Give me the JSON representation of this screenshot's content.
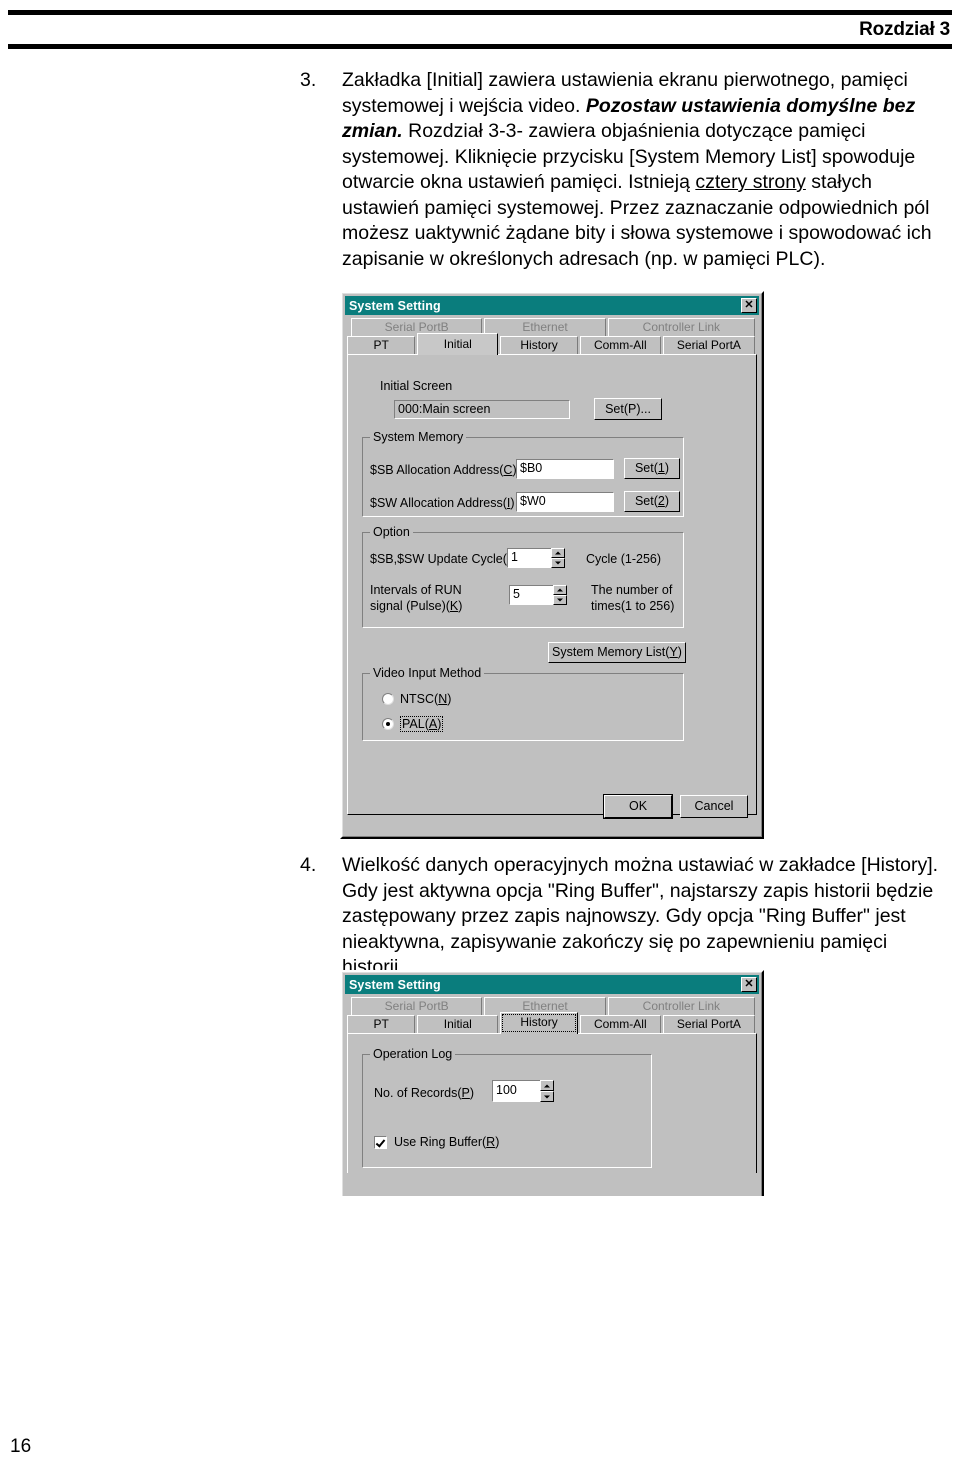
{
  "header": {
    "chapter": "Rozdział 3"
  },
  "footer": {
    "page_number": "16"
  },
  "paragraphs": [
    {
      "number": "3.",
      "runs": [
        {
          "text": "Zakładka [Initial] zawiera ustawienia ekranu pierwotnego, pamięci systemowej i wejścia video. ",
          "style": "normal"
        },
        {
          "text": "Pozostaw ustawienia domyślne bez zmian.",
          "style": "bold-italic"
        },
        {
          "text": " Rozdział 3-3- zawiera objaśnienia dotyczące pamięci systemowej. Kliknięcie przycisku [System Memory List] spowoduje otwarcie okna ustawień pamięci. Istnieją ",
          "style": "normal"
        },
        {
          "text": "cztery strony",
          "style": "underline"
        },
        {
          "text": " stałych ustawień pamięci systemowej. Przez zaznaczanie odpowiednich pól możesz uaktywnić żądane bity i słowa systemowe i spowodować ich zapisanie w określonych adresach (np. w pamięci PLC).",
          "style": "normal"
        }
      ]
    },
    {
      "number": "4.",
      "runs": [
        {
          "text": "Wielkość danych operacyjnych można ustawiać w zakładce [History]. Gdy jest aktywna opcja \"Ring Buffer\", najstarszy zapis historii będzie zastępowany przez zapis najnowszy. Gdy opcja \"Ring Buffer\" jest nieaktywna, zapisywanie zakończy się po zapewnieniu pamięci historii.",
          "style": "normal"
        }
      ]
    }
  ],
  "colors": {
    "titlebar": "#0a7d7d",
    "dialog_face": "#c0c0c0",
    "field_bg": "#ffffff",
    "disabled_text": "#808080"
  },
  "dialog_initial": {
    "title": "System Setting",
    "close_label": "✕",
    "tabs_row1": [
      {
        "label": "Serial PortB",
        "enabled": false
      },
      {
        "label": "Ethernet",
        "enabled": false
      },
      {
        "label": "Controller Link",
        "enabled": false
      }
    ],
    "tabs_row2": [
      {
        "label": "PT",
        "active": false
      },
      {
        "label": "Initial",
        "active": true
      },
      {
        "label": "History",
        "active": false
      },
      {
        "label": "Comm-All",
        "active": false
      },
      {
        "label": "Serial PortA",
        "active": false
      }
    ],
    "initial_screen": {
      "label": "Initial Screen",
      "value": "000:Main screen",
      "set_button": "Set(P)..."
    },
    "system_memory": {
      "group_label": "System Memory",
      "sb_label_pre": "$SB Allocation Address(",
      "sb_label_key": "C",
      "sb_label_post": ")",
      "sb_value": "$B0",
      "sb_button_pre": "Set(",
      "sb_button_key": "1",
      "sb_button_post": ")",
      "sw_label_pre": "$SW Allocation Address(",
      "sw_label_key": "I",
      "sw_label_post": ")",
      "sw_value": "$W0",
      "sw_button_pre": "Set(",
      "sw_button_key": "2",
      "sw_button_post": ")"
    },
    "option": {
      "group_label": "Option",
      "update_cycle_label_pre": "$SB,$SW Update Cycle(",
      "update_cycle_label_key": "P",
      "update_cycle_label_post": ")",
      "update_cycle_value": "1",
      "update_cycle_hint": "Cycle (1-256)",
      "run_interval_label_line1": "Intervals of RUN",
      "run_interval_label_line2_pre": "signal (Pulse)(",
      "run_interval_label_key": "K",
      "run_interval_label_line2_post": ")",
      "run_interval_value": "5",
      "run_interval_hint_line1": "The number of",
      "run_interval_hint_line2": "times(1 to 256)"
    },
    "system_memory_list_button_pre": "System Memory List(",
    "system_memory_list_button_key": "Y",
    "system_memory_list_button_post": ")",
    "video_input": {
      "group_label": "Video Input Method",
      "ntsc_pre": "NTSC(",
      "ntsc_key": "N",
      "ntsc_post": ")",
      "ntsc_selected": false,
      "pal_pre": "PAL(",
      "pal_key": "A",
      "pal_post": ")",
      "pal_selected": true
    },
    "ok_button": "OK",
    "cancel_button": "Cancel"
  },
  "dialog_history": {
    "title": "System Setting",
    "close_label": "✕",
    "tabs_row1": [
      {
        "label": "Serial PortB",
        "enabled": false
      },
      {
        "label": "Ethernet",
        "enabled": false
      },
      {
        "label": "Controller Link",
        "enabled": false
      }
    ],
    "tabs_row2": [
      {
        "label": "PT",
        "active": false
      },
      {
        "label": "Initial",
        "active": false
      },
      {
        "label": "History",
        "active": true
      },
      {
        "label": "Comm-All",
        "active": false
      },
      {
        "label": "Serial PortA",
        "active": false
      }
    ],
    "operation_log": {
      "group_label": "Operation Log",
      "records_label_pre": "No. of Records(",
      "records_label_key": "P",
      "records_label_post": ")",
      "records_value": "100",
      "ring_buffer_pre": "Use Ring Buffer(",
      "ring_buffer_key": "R",
      "ring_buffer_post": ")",
      "ring_buffer_checked": true
    }
  }
}
